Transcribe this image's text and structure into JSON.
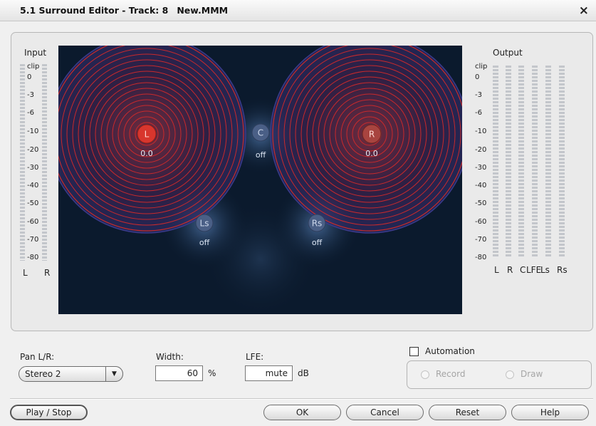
{
  "window": {
    "title": "5.1 Surround Editor - Track: 8",
    "filename": "New.MMM",
    "close_symbol": "×"
  },
  "input_meter": {
    "label": "Input",
    "scale": [
      "clip",
      "0",
      "-3",
      "-6",
      "-10",
      "-20",
      "-30",
      "-40",
      "-50",
      "-60",
      "-70",
      "-80"
    ],
    "channels": [
      "L",
      "R"
    ]
  },
  "output_meter": {
    "label": "Output",
    "scale": [
      "clip",
      "0",
      "-3",
      "-6",
      "-10",
      "-20",
      "-30",
      "-40",
      "-50",
      "-60",
      "-70",
      "-80"
    ],
    "channels": [
      "L",
      "R",
      "C",
      "LFE",
      "Ls",
      "Rs"
    ]
  },
  "speakers": {
    "L": {
      "label": "L",
      "value": "0.0",
      "active": true,
      "color": "#d8362d"
    },
    "R": {
      "label": "R",
      "value": "0.0",
      "active": true,
      "color": "#a8443f"
    },
    "C": {
      "label": "C",
      "value": "off",
      "active": false,
      "color": "#4a5f86"
    },
    "Ls": {
      "label": "Ls",
      "value": "off",
      "active": false,
      "color": "#4a5f86"
    },
    "Rs": {
      "label": "Rs",
      "value": "off",
      "active": false,
      "color": "#4a5f86"
    }
  },
  "controls": {
    "pan_label": "Pan L/R:",
    "pan_value": "Stereo 2",
    "width_label": "Width:",
    "width_value": "60",
    "width_unit": "%",
    "lfe_label": "LFE:",
    "lfe_value": "mute",
    "lfe_unit": "dB",
    "automation_label": "Automation",
    "automation_checked": false,
    "record_label": "Record",
    "draw_label": "Draw"
  },
  "buttons": {
    "play_stop": "Play / Stop",
    "ok": "OK",
    "cancel": "Cancel",
    "reset": "Reset",
    "help": "Help"
  },
  "colors": {
    "stage_background": "#0b1a2d",
    "ring": "#d12a2a",
    "speaker_off_text": "#dde6f4"
  }
}
